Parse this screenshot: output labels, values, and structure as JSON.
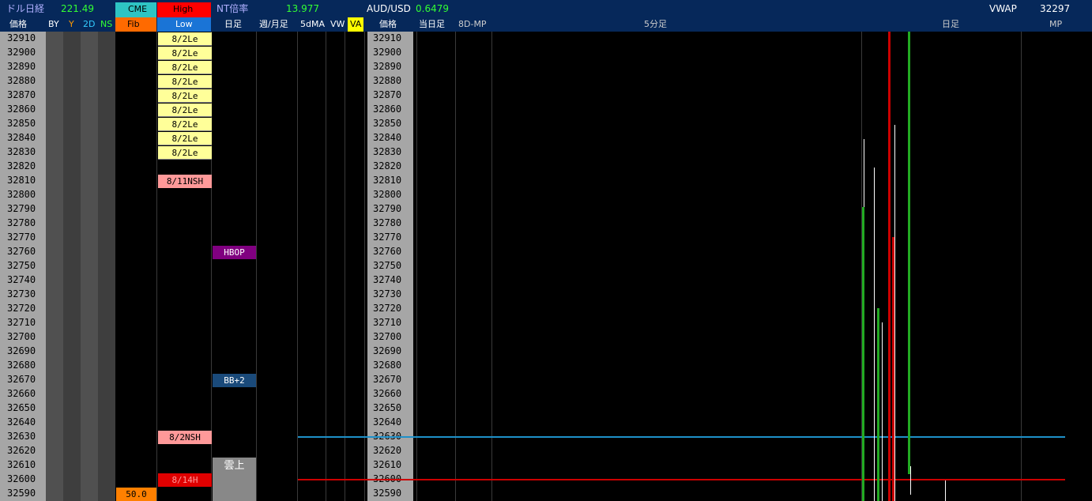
{
  "header": {
    "dollar_nikkei_label": "ドル日経",
    "dollar_nikkei_value": "221.49",
    "cme_label": "CME",
    "high_label": "High",
    "nt_label": "NT倍率",
    "nt_value": "13.977",
    "audusd_label": "AUD/USD",
    "audusd_value": "0.6479",
    "vwap_label": "VWAP",
    "vwap_value": "32297"
  },
  "subheader": {
    "price_label": "価格",
    "by_label": "BY",
    "y_label": "Y",
    "d2_label": "2D",
    "ns_label": "NS",
    "fib_label": "Fib",
    "low_label": "Low",
    "daily_label": "日足",
    "weekly_monthly_label": "週/月足",
    "ma5d_label": "5dMA",
    "vw_label": "VW",
    "va_label": "VA",
    "price2_label": "価格",
    "today_label": "当日足",
    "mp8d_label": "8D-MP",
    "min5_label": "5分足",
    "daily2_label": "日足",
    "mp_label": "MP"
  },
  "prices": [
    "32910",
    "32900",
    "32890",
    "32880",
    "32870",
    "32860",
    "32850",
    "32840",
    "32830",
    "32820",
    "32810",
    "32800",
    "32790",
    "32780",
    "32770",
    "32760",
    "32750",
    "32740",
    "32730",
    "32720",
    "32710",
    "32700",
    "32690",
    "32680",
    "32670",
    "32660",
    "32650",
    "32640",
    "32630",
    "32620",
    "32610",
    "32600",
    "32590"
  ],
  "marks": {
    "high_low_8_2le": "8/2Le",
    "nsh_811": "8/11NSH",
    "nsh_82": "8/2NSH",
    "h_814": "8/14H",
    "hbop": "HBOP",
    "bb2": "BB+2",
    "cloud_top": "雲上",
    "fib_50": "50.0"
  },
  "colors": {
    "header_bg": "#06285a",
    "price_col_bg": "#a0a0a0",
    "le_yellow": "#ffff99",
    "nsh_pink": "#ff9999",
    "h_red": "#e00000",
    "hbop_purple": "#800080",
    "bb_blue": "#1a4a7a",
    "fib_orange": "#ff8000",
    "cloud_gray": "#888888",
    "blue_line": "#1e90c8",
    "red_line": "#cc0000",
    "green_bar": "#22aa22"
  }
}
